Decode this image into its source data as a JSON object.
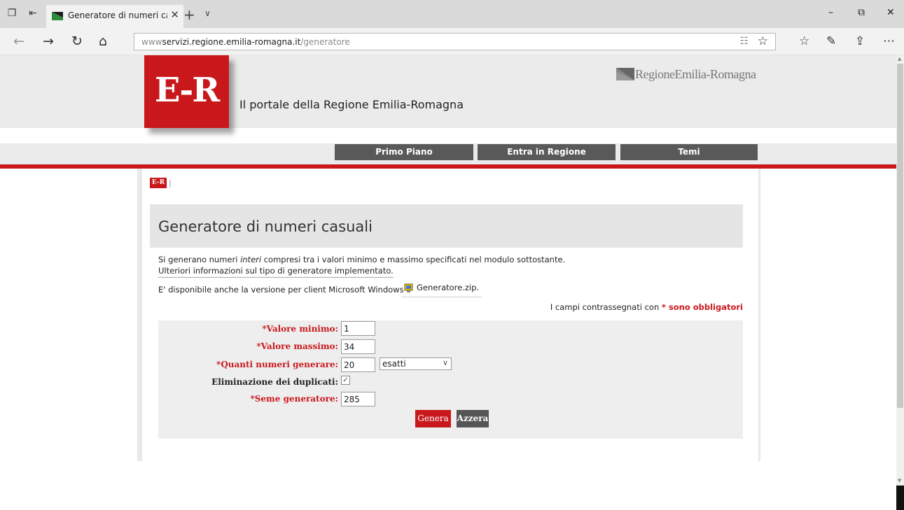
{
  "browser": {
    "tab_title": "Generatore di numeri ca",
    "url_prefix": "www",
    "url_host": "servizi.regione.emilia-romagna.it",
    "url_path": "/generatore"
  },
  "header": {
    "logo_text": "E-R",
    "portal_title": "Il portale della Regione Emilia-Romagna",
    "region_logo_text": "RegioneEmilia-Romagna"
  },
  "menu": {
    "items": [
      "Primo Piano",
      "Entra in Regione",
      "Temi"
    ]
  },
  "breadcrumb": {
    "home_label": "E-R",
    "separator": "|"
  },
  "main": {
    "title": "Generatore di numeri casuali",
    "desc_before": "Si generano numeri ",
    "desc_em": "interi",
    "desc_after": " compresi tra i valori minimo e massimo specificati nel modulo sottostante.",
    "info_link": "Ulteriori informazioni sul tipo di generatore implementato",
    "info_link_dot": ".",
    "windows_text": "E' disponibile anche la versione per client Microsoft Windows",
    "zip_link": "Generatore.zip.",
    "required_before": "I campi contrassegnati con ",
    "required_star": "*",
    "required_after": " sono obbligatori"
  },
  "form": {
    "min_label": "*Valore minimo:",
    "min_value": "1",
    "max_label": "*Valore massimo:",
    "max_value": "34",
    "count_label": "*Quanti numeri generare:",
    "count_value": "20",
    "count_mode": "esatti",
    "dedup_label": "Eliminazione dei duplicati:",
    "dedup_checked": true,
    "seed_label": "*Seme generatore:",
    "seed_value": "285",
    "generate_button": "Genera",
    "reset_button": "Azzera"
  },
  "colors": {
    "brand_red": "#c9181c",
    "menu_gray": "#595959"
  }
}
